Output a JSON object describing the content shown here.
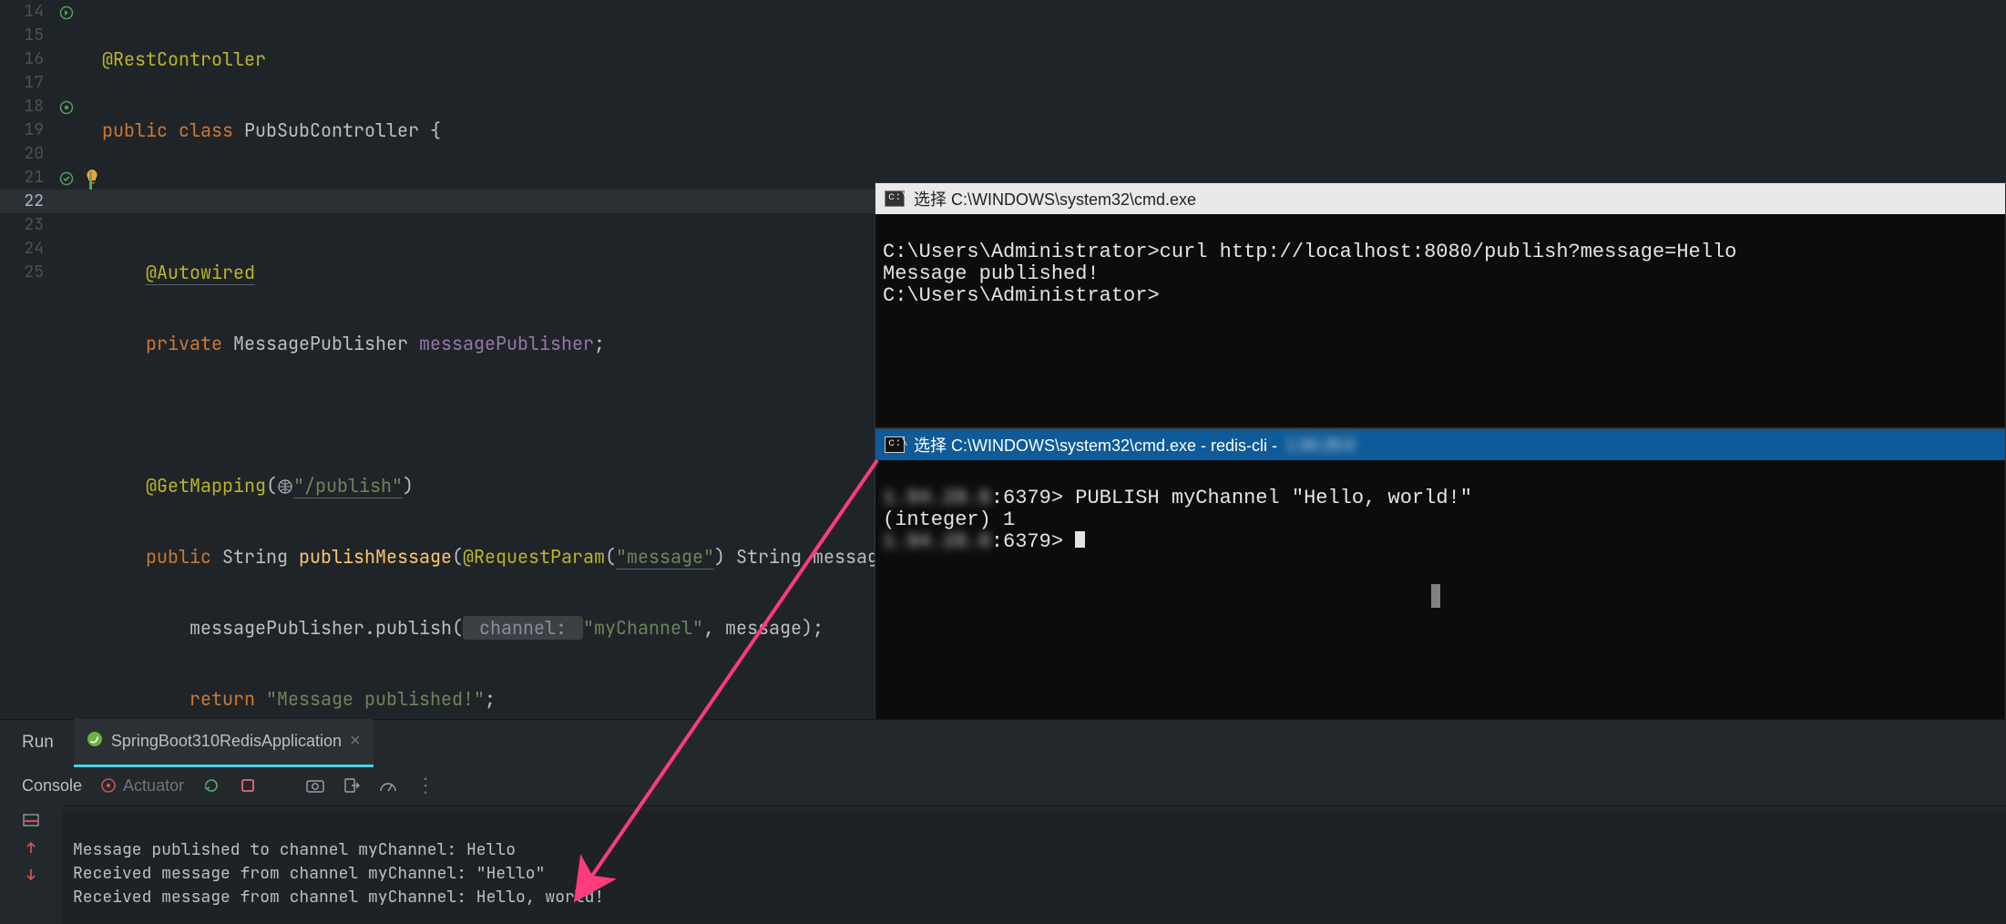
{
  "code_lines": {
    "l14": {
      "n": "14",
      "anno": "@RestController"
    },
    "l15": {
      "n": "15",
      "kw1": "public",
      "kw2": "class",
      "cls": "PubSubController",
      "brace": "{"
    },
    "l16": {
      "n": "16"
    },
    "l17": {
      "n": "17",
      "anno": "@Autowired"
    },
    "l18": {
      "n": "18",
      "kw": "private",
      "ty": "MessagePublisher",
      "fld": "messagePublisher",
      "semi": ";"
    },
    "l19": {
      "n": "19"
    },
    "l20": {
      "n": "20",
      "anno": "@GetMapping",
      "open": "(",
      "icon": "🌐",
      "path": "\"/publish\"",
      "close": ")"
    },
    "l21": {
      "n": "21",
      "kw": "public",
      "ty": "String",
      "fn": "publishMessage",
      "open": "(",
      "anno2": "@RequestParam",
      "open2": "(",
      "msg": "\"message\"",
      "close2": ")",
      "ty2": "String",
      "arg": "message",
      "close3": ") {"
    },
    "l22": {
      "n": "22",
      "obj": "messagePublisher",
      "dot": ".",
      "m": "publish",
      "open": "(",
      "hint": " channel: ",
      "s": "\"myChannel\"",
      "c1": ", ",
      "p": "message",
      "close": ");"
    },
    "l23": {
      "n": "23",
      "kw": "return",
      "s": "\"Message published!\"",
      "semi": ";"
    },
    "l24": {
      "n": "24",
      "brace": "}"
    },
    "l25": {
      "n": "25",
      "brace": "}"
    }
  },
  "cmd_top": {
    "title": "选择 C:\\WINDOWS\\system32\\cmd.exe",
    "line1": "C:\\Users\\Administrator>curl http://localhost:8080/publish?message=Hello",
    "line2": "Message published!",
    "line3": "C:\\Users\\Administrator>"
  },
  "cmd_bot": {
    "title": "选择 C:\\WINDOWS\\system32\\cmd.exe - redis-cli -",
    "host_blur": "1.94.28.6",
    "port": ":6379>",
    "pub": "PUBLISH myChannel \"Hello, world!\"",
    "resp": "(integer) 1"
  },
  "run": {
    "title": "Run",
    "tab": "SpringBoot310RedisApplication",
    "console_tab": "Console",
    "actuator": "Actuator",
    "log1": "Message published to channel myChannel: Hello",
    "log2": "Received message from channel myChannel: \"Hello\"",
    "log3": "Received message from channel myChannel: Hello, world!"
  }
}
